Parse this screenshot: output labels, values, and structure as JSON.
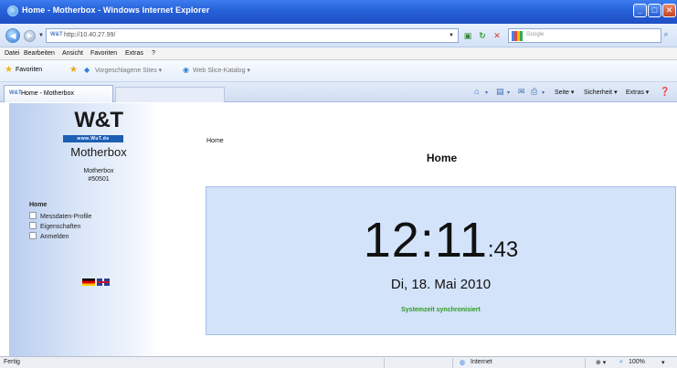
{
  "window": {
    "title": "Home - Motherbox - Windows Internet Explorer",
    "min_label": "_",
    "max_label": "□",
    "close_label": "✕"
  },
  "addressbar": {
    "url": "http://10.40.27.99/",
    "search_placeholder": "Google"
  },
  "menu": {
    "items": [
      "Datei",
      "Bearbeiten",
      "Ansicht",
      "Favoriten",
      "Extras",
      "?"
    ]
  },
  "favorites": {
    "label": "Favoriten",
    "suggested_sites": "Vorgeschlagene Sites ▾",
    "web_slice": "Web Slice-Katalog ▾"
  },
  "tabs": {
    "active_label": "Home - Motherbox"
  },
  "commandbar": {
    "page": "Seite ▾",
    "safety": "Sicherheit ▾",
    "tools": "Extras ▾"
  },
  "sidebar": {
    "logo": "W&T",
    "logo_url": "www.WuT.de",
    "product": "Motherbox",
    "device_line1": "Motherbox",
    "device_line2": "#50501",
    "home": "Home",
    "nav": [
      "Messdaten-Profile",
      "Eigenschaften",
      "Anmelden"
    ]
  },
  "main": {
    "breadcrumb": "Home",
    "title": "Home",
    "time_hm": "12:11",
    "time_sec": ":43",
    "date": "Di, 18. Mai 2010",
    "sync_status": "Systemzeit synchronisiert"
  },
  "statusbar": {
    "left": "Fertig",
    "zone": "Internet",
    "zoom": "100%"
  },
  "colors": {
    "titlebar": "#2660d8",
    "clockbox": "#d3e3fa",
    "sync_text": "#2f9a1f",
    "logo_bar": "#1d5fb3"
  }
}
